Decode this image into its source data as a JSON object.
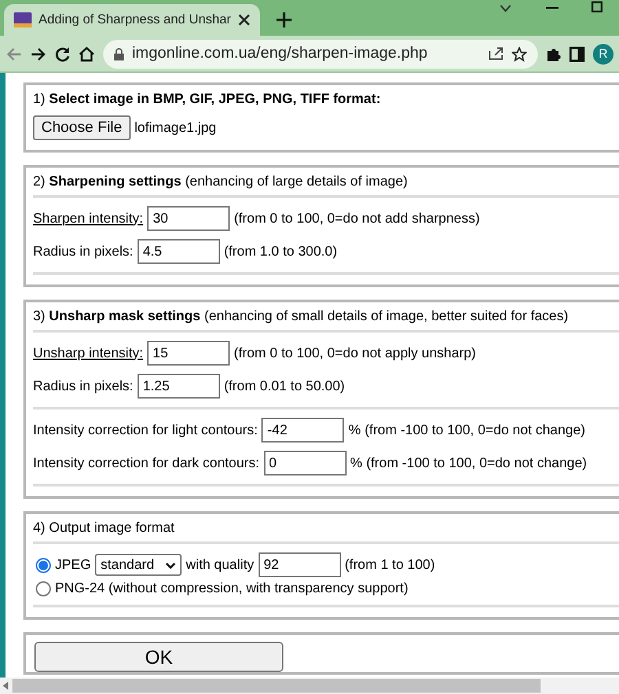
{
  "browser": {
    "tab_title": "Adding of Sharpness and Unshar",
    "url": "imgonline.com.ua/eng/sharpen-image.php",
    "profile": "R"
  },
  "sections": [
    {
      "kind": "file",
      "heading": "1) **Select image in BMP, GIF, JPEG, PNG, TIFF format:**",
      "button": "Choose File",
      "file_name": "lofimage1.jpg"
    },
    {
      "kind": "fields",
      "heading": "2) **Sharpening settings** (enhancing of large details of image)",
      "groups": [
        [
          {
            "label": "Sharpen intensity:",
            "underlined": true,
            "value": "30",
            "hint": "(from 0 to 100, 0=do not add sharpness)"
          },
          {
            "label": "Radius in pixels:",
            "underlined": false,
            "value": "4.5",
            "hint": "(from 1.0 to 300.0)"
          }
        ]
      ]
    },
    {
      "kind": "fields",
      "heading": "3) **Unsharp mask settings** (enhancing of small details of image, better suited for faces)",
      "groups": [
        [
          {
            "label": "Unsharp intensity:",
            "underlined": true,
            "value": "15",
            "hint": "(from 0 to 100, 0=do not apply unsharp)"
          },
          {
            "label": "Radius in pixels:",
            "underlined": false,
            "value": "1.25",
            "hint": "(from 0.01 to 50.00)"
          }
        ],
        [
          {
            "label": "Intensity correction for light contours:",
            "underlined": false,
            "value": "-42",
            "hint": "% (from -100 to 100, 0=do not change)"
          },
          {
            "label": "Intensity correction for dark contours:",
            "underlined": false,
            "value": "0",
            "hint": "% (from -100 to 100, 0=do not change)"
          }
        ]
      ]
    },
    {
      "kind": "format",
      "heading": "4) Output image format",
      "options": [
        {
          "label": "JPEG",
          "selected": true,
          "select": "standard",
          "quality_label": "with quality",
          "value": "92",
          "hint": "(from 1 to 100)"
        },
        {
          "label": "PNG-24 (without compression, with transparency support)",
          "selected": false
        }
      ]
    },
    {
      "kind": "submit",
      "button": "OK"
    }
  ]
}
